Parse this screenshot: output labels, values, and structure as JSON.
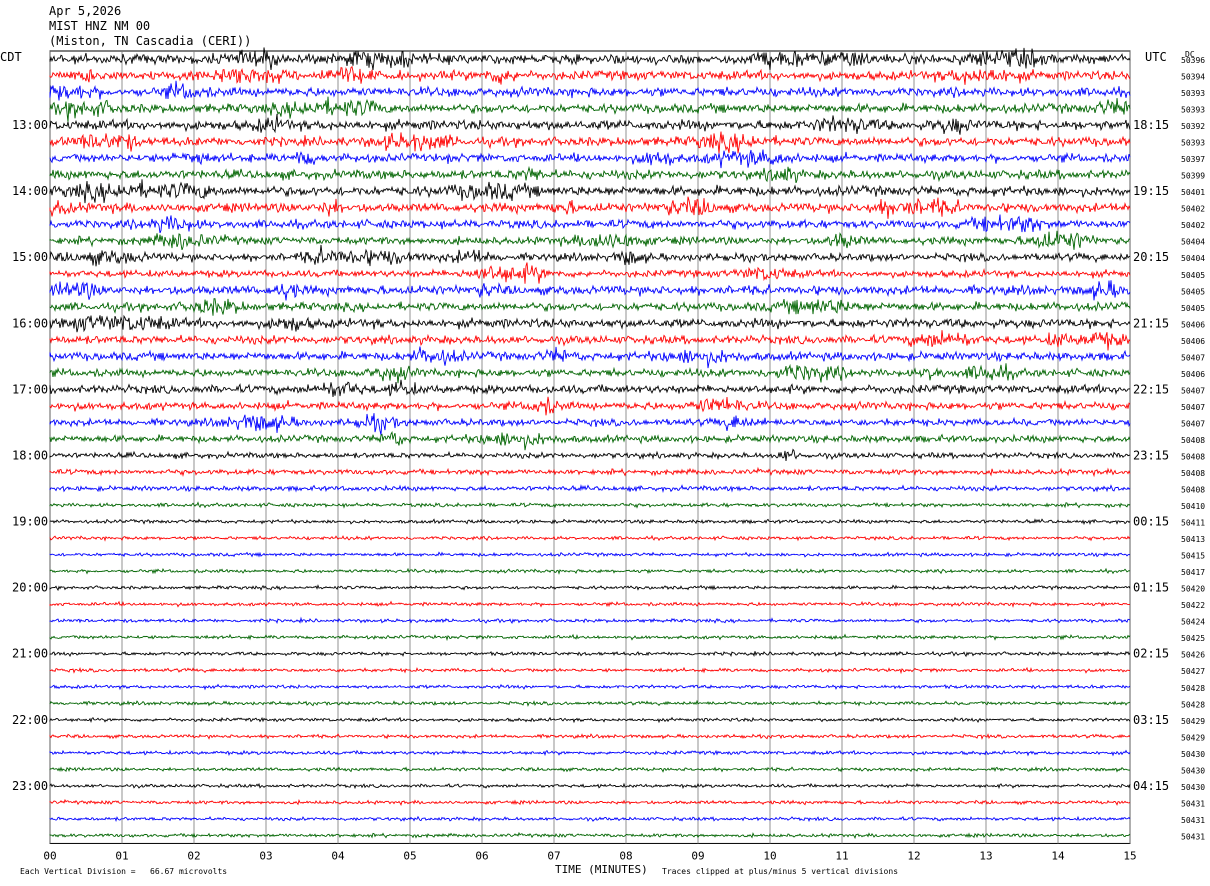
{
  "header": {
    "date": "Apr 5,2026",
    "station": "MIST HNZ NM 00",
    "location": "(Miston, TN Cascadia (CERI))"
  },
  "left_tz": "CDT",
  "right_tz": "UTC",
  "dc_label": "DC",
  "footer": {
    "scale": "Each Vertical Division =   66.67 microvolts",
    "xaxis_title": "TIME (MINUTES)",
    "clip_note": "Traces clipped at plus/minus 5 vertical divisions"
  },
  "chart_data": {
    "type": "line",
    "title": "MIST HNZ NM 00",
    "xlabel": "TIME (MINUTES)",
    "x_range": [
      0,
      15
    ],
    "x_ticks": [
      "00",
      "01",
      "02",
      "03",
      "04",
      "05",
      "06",
      "07",
      "08",
      "09",
      "10",
      "11",
      "12",
      "13",
      "14",
      "15"
    ],
    "trace_colors": [
      "#000000",
      "#ff0000",
      "#0000ff",
      "#006400"
    ],
    "left_hour_labels": [
      "13:00",
      "14:00",
      "15:00",
      "16:00",
      "17:00",
      "18:00",
      "19:00",
      "20:00",
      "21:00",
      "22:00",
      "23:00"
    ],
    "right_hour_labels": [
      "18:15",
      "19:15",
      "20:15",
      "21:15",
      "22:15",
      "23:15",
      "00:15",
      "01:15",
      "02:15",
      "03:15",
      "04:15"
    ],
    "dc_offsets": [
      "50396",
      "50394",
      "50393",
      "50393",
      "50392",
      "50393",
      "50397",
      "50399",
      "50401",
      "50402",
      "50402",
      "50404",
      "50404",
      "50405",
      "50405",
      "50405",
      "50406",
      "50406",
      "50407",
      "50406",
      "50407",
      "50407",
      "50407",
      "50408",
      "50408",
      "50408",
      "50408",
      "50410",
      "50411",
      "50413",
      "50415",
      "50417",
      "50420",
      "50422",
      "50424",
      "50425",
      "50426",
      "50427",
      "50428",
      "50428",
      "50429",
      "50429",
      "50430",
      "50430",
      "50430",
      "50431",
      "50431",
      "50431"
    ],
    "trace_activity": [
      1.0,
      0.9,
      0.9,
      0.9,
      1.0,
      0.9,
      0.8,
      0.9,
      1.0,
      0.9,
      0.8,
      0.7,
      0.7,
      0.6,
      0.9,
      0.8,
      0.9,
      0.8,
      0.8,
      0.7,
      0.8,
      0.7,
      0.6,
      0.6,
      0.4,
      0.35,
      0.3,
      0.15,
      0.12,
      0.1,
      0.1,
      0.1,
      0.1,
      0.1,
      0.1,
      0.1,
      0.12,
      0.1,
      0.1,
      0.1,
      0.1,
      0.1,
      0.12,
      0.1,
      0.1,
      0.1,
      0.1,
      0.1
    ]
  }
}
